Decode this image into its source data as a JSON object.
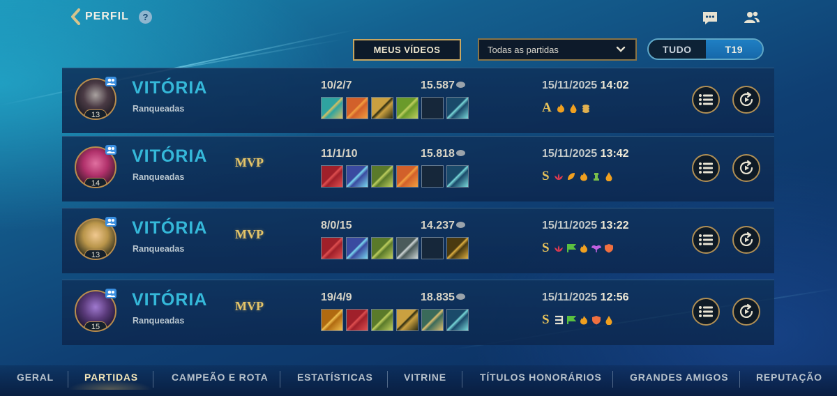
{
  "header": {
    "title": "PERFIL",
    "help_glyph": "?",
    "icons": [
      "chevron-left-icon",
      "help-icon",
      "chat-icon",
      "friends-icon"
    ]
  },
  "controls": {
    "videos_button": "MEUS VÍDEOS",
    "match_filter": "Todas as partidas",
    "toggle": [
      "TUDO",
      "T19"
    ],
    "toggle_active": "T19"
  },
  "matches": [
    {
      "result": "VITÓRIA",
      "mode": "Ranqueadas",
      "level": "13",
      "mvp": "",
      "kda": "10/2/7",
      "gold": "15.587",
      "date": "15/11/2025",
      "time": "14:02",
      "grade": "A",
      "badge_icons": [
        "flame-icon",
        "drop-icon",
        "coins-icon"
      ]
    },
    {
      "result": "VITÓRIA",
      "mode": "Ranqueadas",
      "level": "14",
      "mvp": "MVP",
      "kda": "11/1/10",
      "gold": "15.818",
      "date": "15/11/2025",
      "time": "13:42",
      "grade": "S",
      "badge_icons": [
        "lotus-icon",
        "leaf-icon",
        "flame-icon",
        "tower-icon",
        "drop-icon"
      ]
    },
    {
      "result": "VITÓRIA",
      "mode": "Ranqueadas",
      "level": "13",
      "mvp": "MVP",
      "kda": "8/0/15",
      "gold": "14.237",
      "date": "15/11/2025",
      "time": "13:22",
      "grade": "S",
      "badge_icons": [
        "lotus-icon",
        "flag-icon",
        "flame-icon",
        "wings-icon",
        "shield-icon"
      ]
    },
    {
      "result": "VITÓRIA",
      "mode": "Ranqueadas",
      "level": "15",
      "mvp": "MVP",
      "kda": "19/4/9",
      "gold": "18.835",
      "date": "15/11/2025",
      "time": "12:56",
      "grade": "S",
      "badge_icons": [
        "triple-kill-icon",
        "flag-icon",
        "flame-icon",
        "shield-icon",
        "drop-icon"
      ]
    }
  ],
  "bottom_nav": {
    "tabs": [
      "GERAL",
      "PARTIDAS",
      "CAMPEÃO E ROTA",
      "ESTATÍSTICAS",
      "VITRINE",
      "TÍTULOS HONORÁRIOS",
      "GRANDES AMIGOS",
      "REPUTAÇÃO"
    ],
    "active": "PARTIDAS"
  },
  "colors": {
    "victory": "#35b8d9",
    "mvp_gold": "#e5c569",
    "frame_gold": "#b08f55",
    "active_toggle": "#1668aa"
  }
}
